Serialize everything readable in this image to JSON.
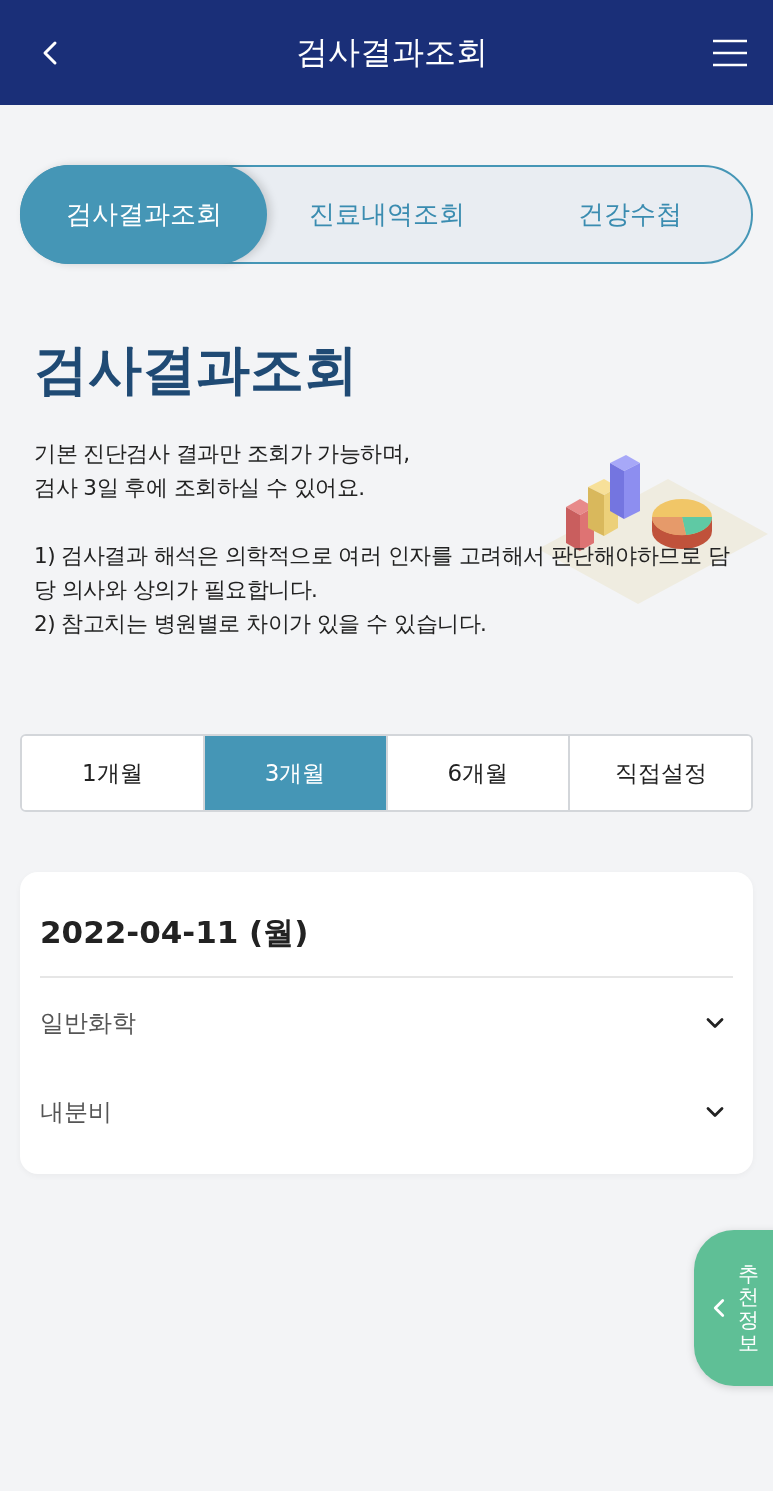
{
  "header": {
    "title": "검사결과조회"
  },
  "tabs": [
    {
      "label": "검사결과조회",
      "selected": true
    },
    {
      "label": "진료내역조회",
      "selected": false
    },
    {
      "label": "건강수첩",
      "selected": false
    }
  ],
  "intro": {
    "heading": "검사결과조회",
    "lines": [
      "기본 진단검사 결과만 조회가 가능하며,",
      "검사 3일 후에 조회하실 수 있어요."
    ],
    "notes": [
      "1) 검사결과 해석은 의학적으로 여러 인자를 고려해서 판단해야하므로 담당 의사와 상의가 필요합니다.",
      "2) 참고치는 병원별로 차이가 있을 수 있습니다."
    ]
  },
  "periods": [
    {
      "label": "1개월",
      "selected": false
    },
    {
      "label": "3개월",
      "selected": true
    },
    {
      "label": "6개월",
      "selected": false
    },
    {
      "label": "직접설정",
      "selected": false
    }
  ],
  "result": {
    "date": "2022-04-11 (월)",
    "items": [
      {
        "label": "일반화학",
        "expanded": false
      },
      {
        "label": "내분비",
        "expanded": false
      }
    ]
  },
  "side_tab": {
    "label": "추천정보"
  }
}
